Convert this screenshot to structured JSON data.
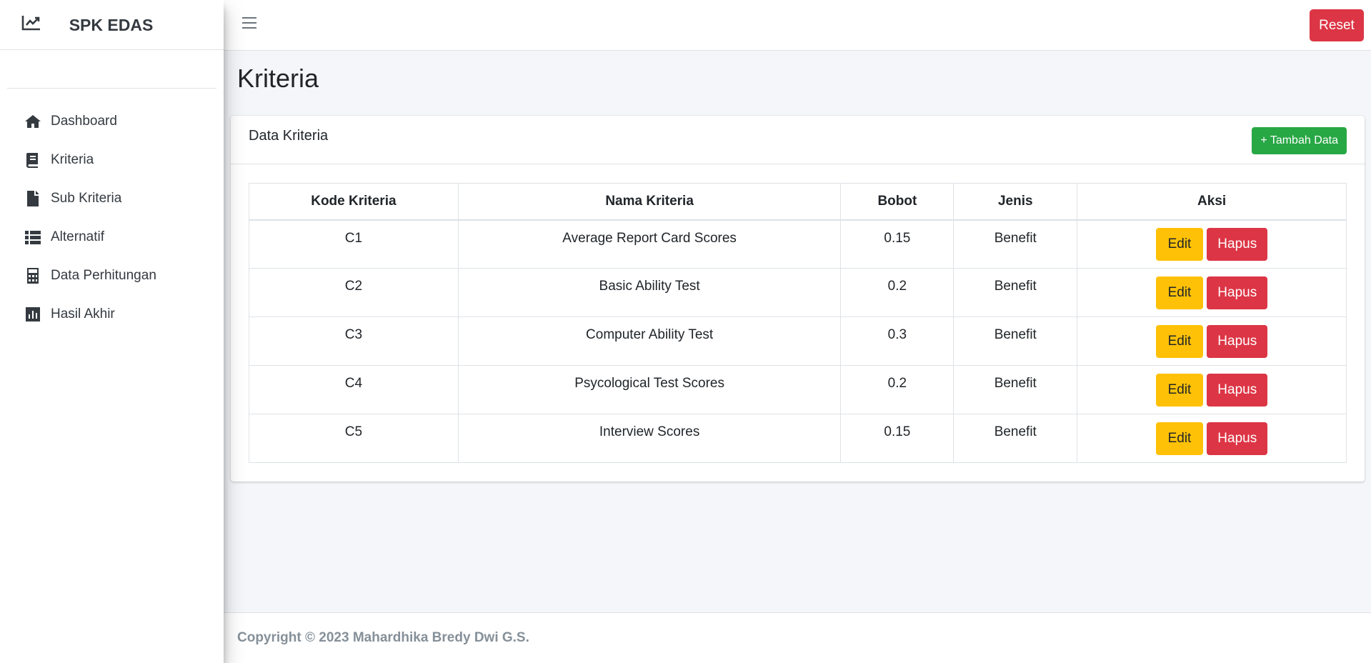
{
  "brand": {
    "name": "SPK EDAS",
    "icon": "chart-line-icon"
  },
  "sidebar": {
    "items": [
      {
        "label": "Dashboard",
        "icon": "home-icon"
      },
      {
        "label": "Kriteria",
        "icon": "book-icon"
      },
      {
        "label": "Sub Kriteria",
        "icon": "file-icon"
      },
      {
        "label": "Alternatif",
        "icon": "list-icon"
      },
      {
        "label": "Data Perhitungan",
        "icon": "calculator-icon"
      },
      {
        "label": "Hasil Akhir",
        "icon": "chart-bar-icon"
      }
    ]
  },
  "topbar": {
    "reset_label": "Reset"
  },
  "page": {
    "title": "Kriteria"
  },
  "card": {
    "title": "Data Kriteria",
    "add_label": "+ Tambah Data"
  },
  "table": {
    "headers": [
      "Kode Kriteria",
      "Nama Kriteria",
      "Bobot",
      "Jenis",
      "Aksi"
    ],
    "rows": [
      {
        "kode": "C1",
        "nama": "Average Report Card Scores",
        "bobot": "0.15",
        "jenis": "Benefit"
      },
      {
        "kode": "C2",
        "nama": "Basic Ability Test",
        "bobot": "0.2",
        "jenis": "Benefit"
      },
      {
        "kode": "C3",
        "nama": "Computer Ability Test",
        "bobot": "0.3",
        "jenis": "Benefit"
      },
      {
        "kode": "C4",
        "nama": "Psycological Test Scores",
        "bobot": "0.2",
        "jenis": "Benefit"
      },
      {
        "kode": "C5",
        "nama": "Interview Scores",
        "bobot": "0.15",
        "jenis": "Benefit"
      }
    ],
    "edit_label": "Edit",
    "hapus_label": "Hapus"
  },
  "footer": {
    "text": "Copyright © 2023 Mahardhika Bredy Dwi G.S."
  },
  "colors": {
    "danger": "#dc3545",
    "warning": "#ffc107",
    "success": "#28a745",
    "text": "#343a40"
  }
}
